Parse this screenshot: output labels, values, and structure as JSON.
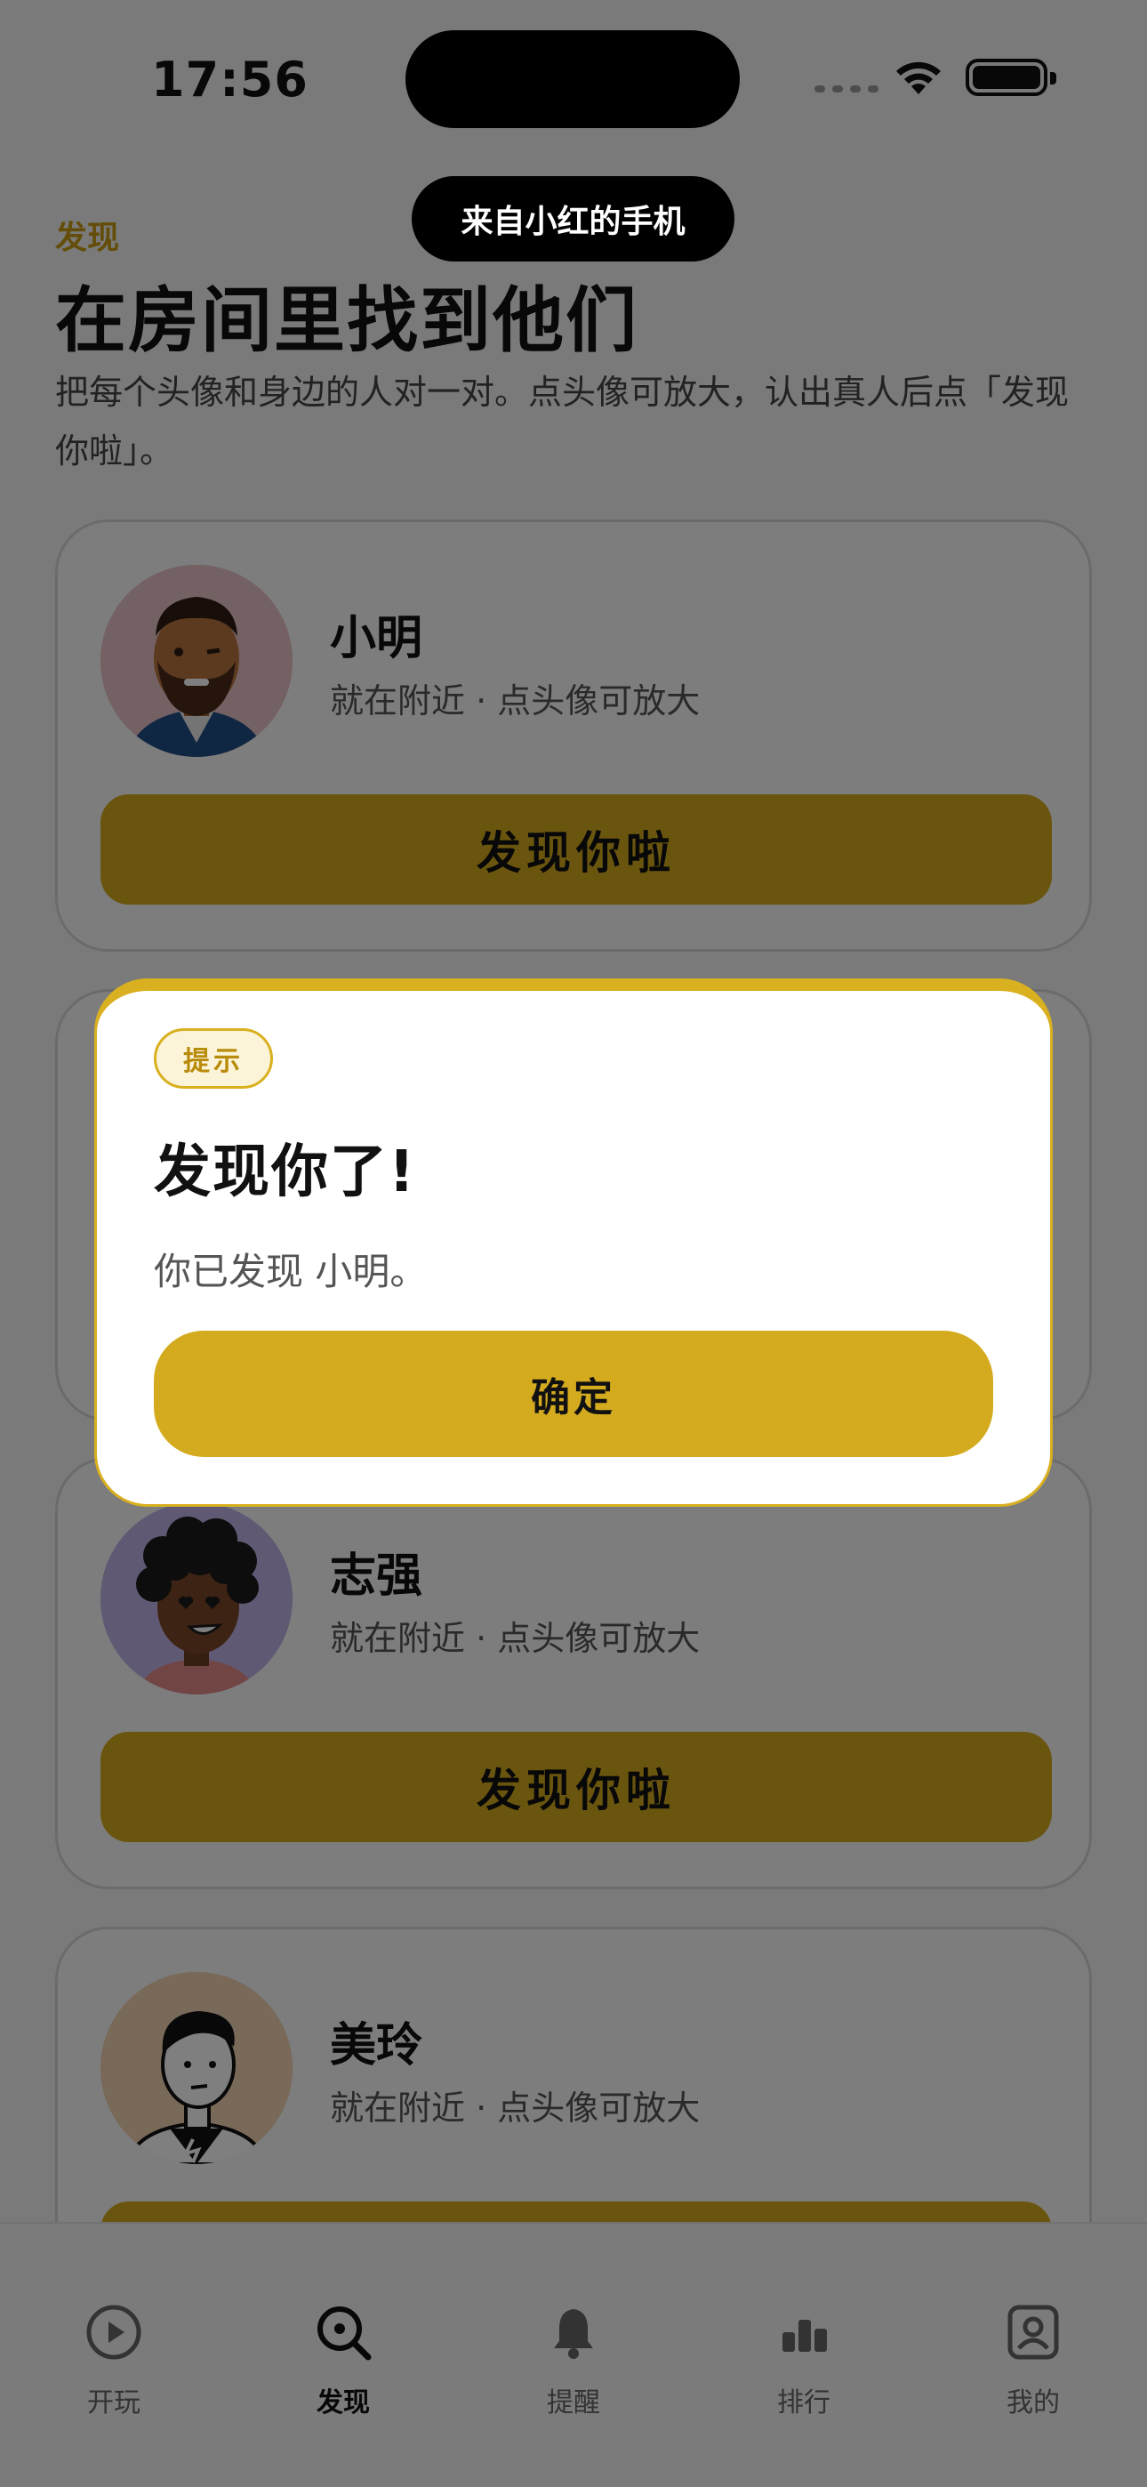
{
  "status_bar": {
    "time": "17:56"
  },
  "toast": {
    "text": "来自小红的手机"
  },
  "header": {
    "eyebrow": "发现",
    "title": "在房间里找到他们",
    "description": "把每个头像和身边的人对一对。点头像可放大，认出真人后点「发现你啦」。"
  },
  "people": [
    {
      "name": "小明",
      "subtitle": "就在附近 · 点头像可放大",
      "button": "发现你啦"
    },
    {
      "name": "",
      "subtitle": "",
      "button": ""
    },
    {
      "name": "志强",
      "subtitle": "就在附近 · 点头像可放大",
      "button": "发现你啦"
    },
    {
      "name": "美玲",
      "subtitle": "就在附近 · 点头像可放大",
      "button": ""
    }
  ],
  "dialog": {
    "badge": "提示",
    "title": "发现你了!",
    "message": "你已发现 小明。",
    "confirm": "确定"
  },
  "tabs": [
    {
      "label": "开玩",
      "icon": "play-icon"
    },
    {
      "label": "发现",
      "icon": "search-icon",
      "active": true
    },
    {
      "label": "提醒",
      "icon": "bell-icon"
    },
    {
      "label": "排行",
      "icon": "bar-chart-icon"
    },
    {
      "label": "我的",
      "icon": "profile-icon"
    }
  ],
  "colors": {
    "accent": "#d4ab1f",
    "accent_text": "#c79a12"
  }
}
